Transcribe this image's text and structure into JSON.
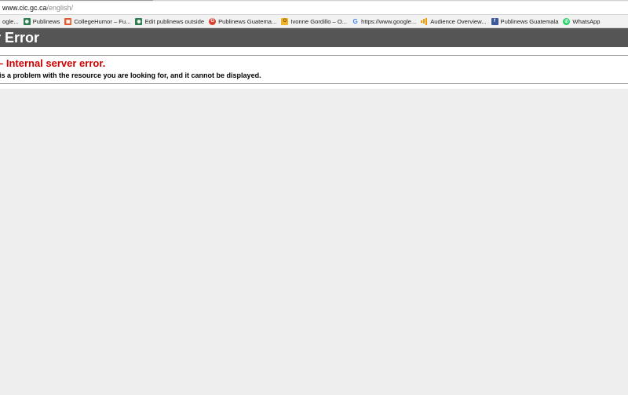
{
  "browser": {
    "url_host": "www.cic.gc.ca",
    "url_path": "/english/",
    "bookmarks": [
      {
        "label": "ogle...",
        "icon": "google-icon"
      },
      {
        "label": "Publinews",
        "icon": "publinews-icon"
      },
      {
        "label": "CollegeHumor – Fu...",
        "icon": "collegehumor-icon"
      },
      {
        "label": "Edit publinews outside",
        "icon": "publinews-icon"
      },
      {
        "label": "Publinews Guatema...",
        "icon": "google-plus-icon"
      },
      {
        "label": "Ivonne Gordillo – O...",
        "icon": "outlook-icon"
      },
      {
        "label": "https://www.google...",
        "icon": "google-icon"
      },
      {
        "label": "Audience Overview...",
        "icon": "analytics-icon"
      },
      {
        "label": "Publinews Guatemala",
        "icon": "facebook-icon"
      },
      {
        "label": "WhatsApp",
        "icon": "whatsapp-icon"
      }
    ]
  },
  "page": {
    "title": "r Error",
    "error_heading": "– Internal server error.",
    "error_description": "is a problem with the resource you are looking for, and it cannot be displayed."
  },
  "colors": {
    "title_bar": "#555555",
    "error_heading": "#cc0000",
    "background": "#eeeeee"
  }
}
